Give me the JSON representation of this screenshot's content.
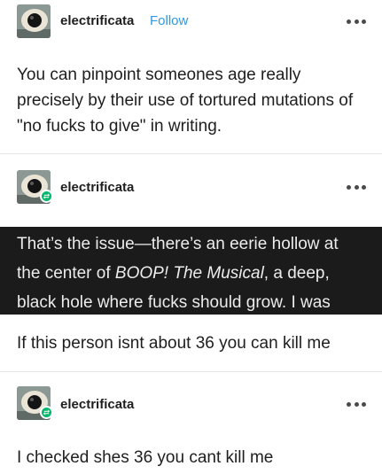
{
  "posts": [
    {
      "username": "electrificata",
      "follow_label": "Follow",
      "text": "You can pinpoint someones age really precisely by their use of tortured mutations of \"no fucks to give\" in writing."
    },
    {
      "username": "electrificata",
      "quote_image": {
        "line1": "That’s the issue—there’s an eerie hollow at",
        "line2_pre": "the center of ",
        "line2_italic": "BOOP! The Musical",
        "line2_post": ", a deep,",
        "line3": "black hole where fucks should grow. I was"
      },
      "text": "If this person isnt about 36 you can kill me"
    },
    {
      "username": "electrificata",
      "text": "I checked shes 36 you cant kill me"
    }
  ],
  "icons": {
    "more": "more-horizontal-icon",
    "reblog": "reblog-icon"
  },
  "colors": {
    "follow": "#2f98e3",
    "reblog_badge": "#00b86b",
    "quote_bg": "#1b1b1b"
  }
}
